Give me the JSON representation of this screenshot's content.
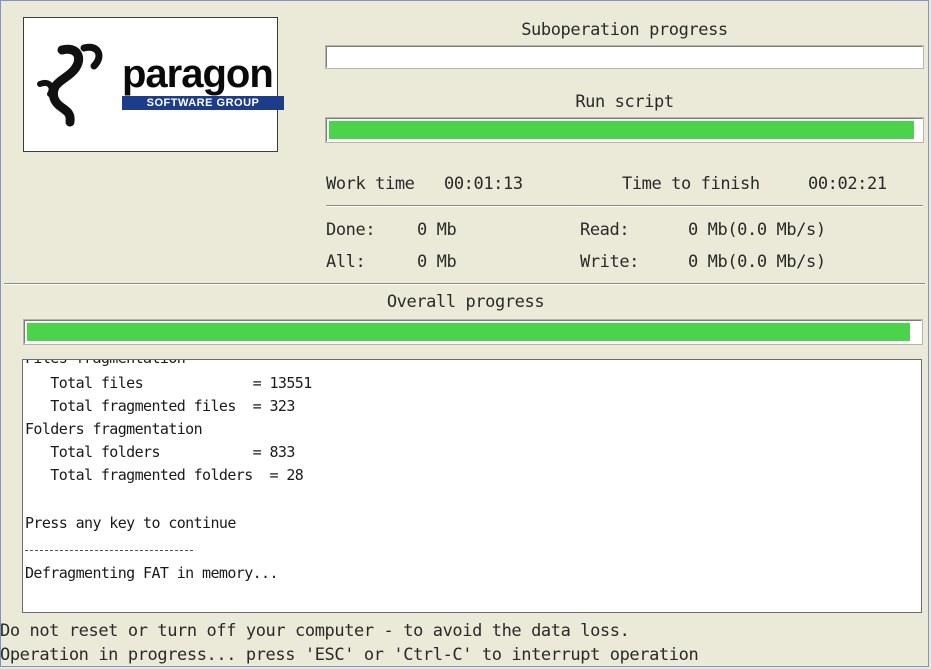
{
  "logo": {
    "brand": "paragon",
    "subtitle": "SOFTWARE GROUP"
  },
  "suboperation": {
    "title": "Suboperation progress",
    "progress": 0.0
  },
  "current_operation": {
    "title": "Run script",
    "progress": 0.99
  },
  "times": {
    "work_time_label": "Work time",
    "work_time_value": "00:01:13",
    "finish_label": "Time to finish",
    "finish_value": "00:02:21"
  },
  "stats": {
    "done_label": "Done:",
    "done_value": "0 Mb",
    "all_label": "All:",
    "all_value": "0 Mb",
    "read_label": "Read:",
    "read_value": "0 Mb(0.0 Mb/s)",
    "write_label": "Write:",
    "write_value": "0 Mb(0.0 Mb/s)"
  },
  "overall": {
    "title": "Overall progress",
    "progress": 0.99
  },
  "log": {
    "partial_header": "Files fragmentation",
    "lines": [
      "   Total files             = 13551",
      "   Total fragmented files  = 323",
      "Folders fragmentation",
      "   Total folders           = 833",
      "   Total fragmented folders  = 28",
      "",
      "Press any key to continue",
      "",
      "Defragmenting FAT in memory..."
    ]
  },
  "footer": {
    "warning": "Do not reset or turn off your computer - to avoid the data loss.",
    "hint": "Operation in progress... press 'ESC' or 'Ctrl-C' to interrupt operation"
  },
  "colors": {
    "background": "#ebe9d7",
    "progress_fill": "#4bd34b",
    "logo_band": "#1d3d8a"
  }
}
